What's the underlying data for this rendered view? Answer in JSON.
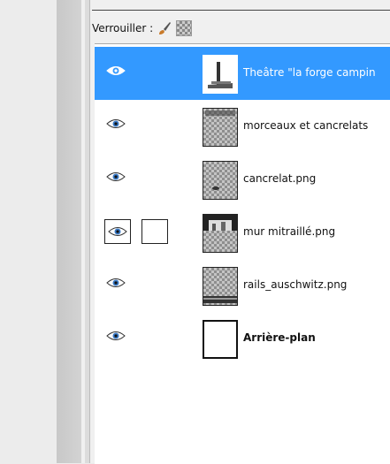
{
  "lock": {
    "label": "Verrouiller :",
    "icons": [
      "paintbrush-icon",
      "alpha-lock-icon"
    ]
  },
  "layers": [
    {
      "name": "Theâtre \"la forge campin",
      "visible": true,
      "selected": true,
      "thumb": "theatre",
      "bold": false
    },
    {
      "name": "morceaux et cancrelats",
      "visible": true,
      "selected": false,
      "thumb": "checker",
      "bold": false
    },
    {
      "name": "cancrelat.png",
      "visible": true,
      "selected": false,
      "thumb": "checker",
      "bold": false
    },
    {
      "name": "mur mitraillé.png",
      "visible": true,
      "selected": false,
      "thumb": "wall",
      "bold": false,
      "linked_boxes": true
    },
    {
      "name": "rails_auschwitz.png",
      "visible": true,
      "selected": false,
      "thumb": "rails",
      "bold": false
    },
    {
      "name": "Arrière-plan",
      "visible": true,
      "selected": false,
      "thumb": "white",
      "bold": true
    }
  ],
  "colors": {
    "selection": "#3399ff",
    "panel": "#f0f0f0",
    "list_bg": "#ffffff"
  }
}
